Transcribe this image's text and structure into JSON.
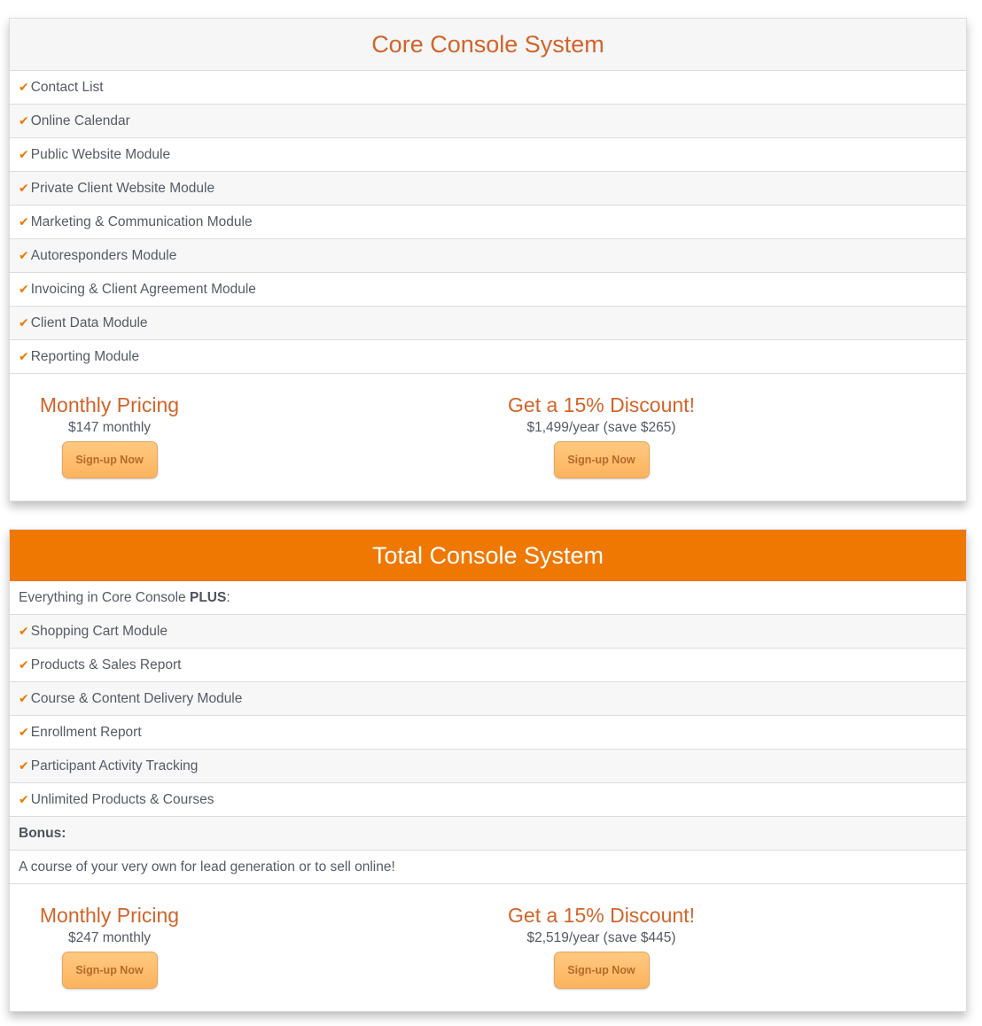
{
  "core": {
    "title": "Core Console System",
    "features": [
      "Contact List",
      "Online Calendar",
      "Public Website Module",
      "Private Client Website Module",
      "Marketing & Communication Module",
      "Autoresponders Module",
      "Invoicing & Client Agreement Module",
      "Client Data Module",
      "Reporting Module"
    ],
    "monthly": {
      "title": "Monthly Pricing",
      "price": "$147 monthly",
      "button": "Sign-up Now"
    },
    "annual": {
      "title": "Get a 15% Discount!",
      "price": "$1,499/year (save $265)",
      "button": "Sign-up Now"
    }
  },
  "total": {
    "title": "Total Console System",
    "intro_prefix": "Everything in Core Console ",
    "intro_bold": "PLUS",
    "intro_suffix": ":",
    "features": [
      "Shopping Cart Module",
      "Products & Sales Report",
      "Course & Content Delivery Module",
      "Enrollment Report",
      "Participant Activity Tracking",
      "Unlimited Products & Courses"
    ],
    "bonus_label": "Bonus:",
    "bonus_text": "A course of your very own for lead generation or to sell online!",
    "monthly": {
      "title": "Monthly Pricing",
      "price": "$247 monthly",
      "button": "Sign-up Now"
    },
    "annual": {
      "title": "Get a 15% Discount!",
      "price": "$2,519/year (save $445)",
      "button": "Sign-up Now"
    }
  },
  "icons": {
    "check": "✔"
  },
  "colors": {
    "accent": "#ee7802",
    "title_orange": "#d2642a",
    "button_fill": "#fcb35d"
  }
}
